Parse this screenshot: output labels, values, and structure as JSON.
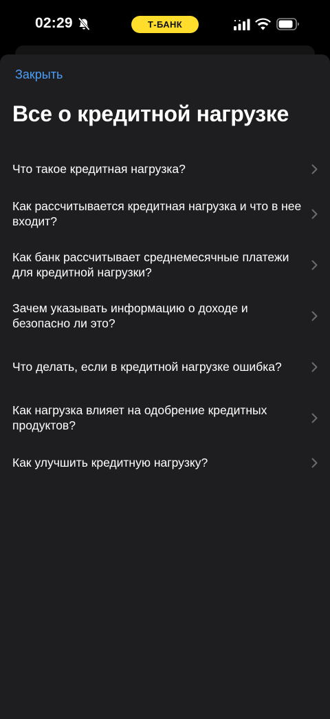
{
  "status_bar": {
    "time": "02:29",
    "carrier": "Т-БАНК",
    "icons": [
      "bell-slash-icon",
      "cellular-signal-icon",
      "wifi-icon",
      "battery-icon"
    ]
  },
  "sheet": {
    "close_label": "Закрыть",
    "title": "Все о кредитной нагрузке",
    "items": [
      {
        "label": "Что такое кредитная нагрузка?"
      },
      {
        "label": "Как рассчитывается кредитная нагрузка и что в нее входит?"
      },
      {
        "label": "Как банк рассчитывает среднемесячные платежи для кредитной нагрузки?"
      },
      {
        "label": "Зачем указывать информацию о доходе и безопасно ли это?"
      },
      {
        "label": "Что делать, если в кредитной нагрузке ошибка?"
      },
      {
        "label": "Как нагрузка влияет на одобрение кредитных продуктов?"
      },
      {
        "label": "Как улучшить кредитную нагрузку?"
      }
    ]
  },
  "colors": {
    "background": "#000000",
    "sheet": "#1e1e20",
    "link": "#4d9ef7",
    "brand_yellow": "#ffdd2d",
    "chevron": "#6b6b70"
  }
}
